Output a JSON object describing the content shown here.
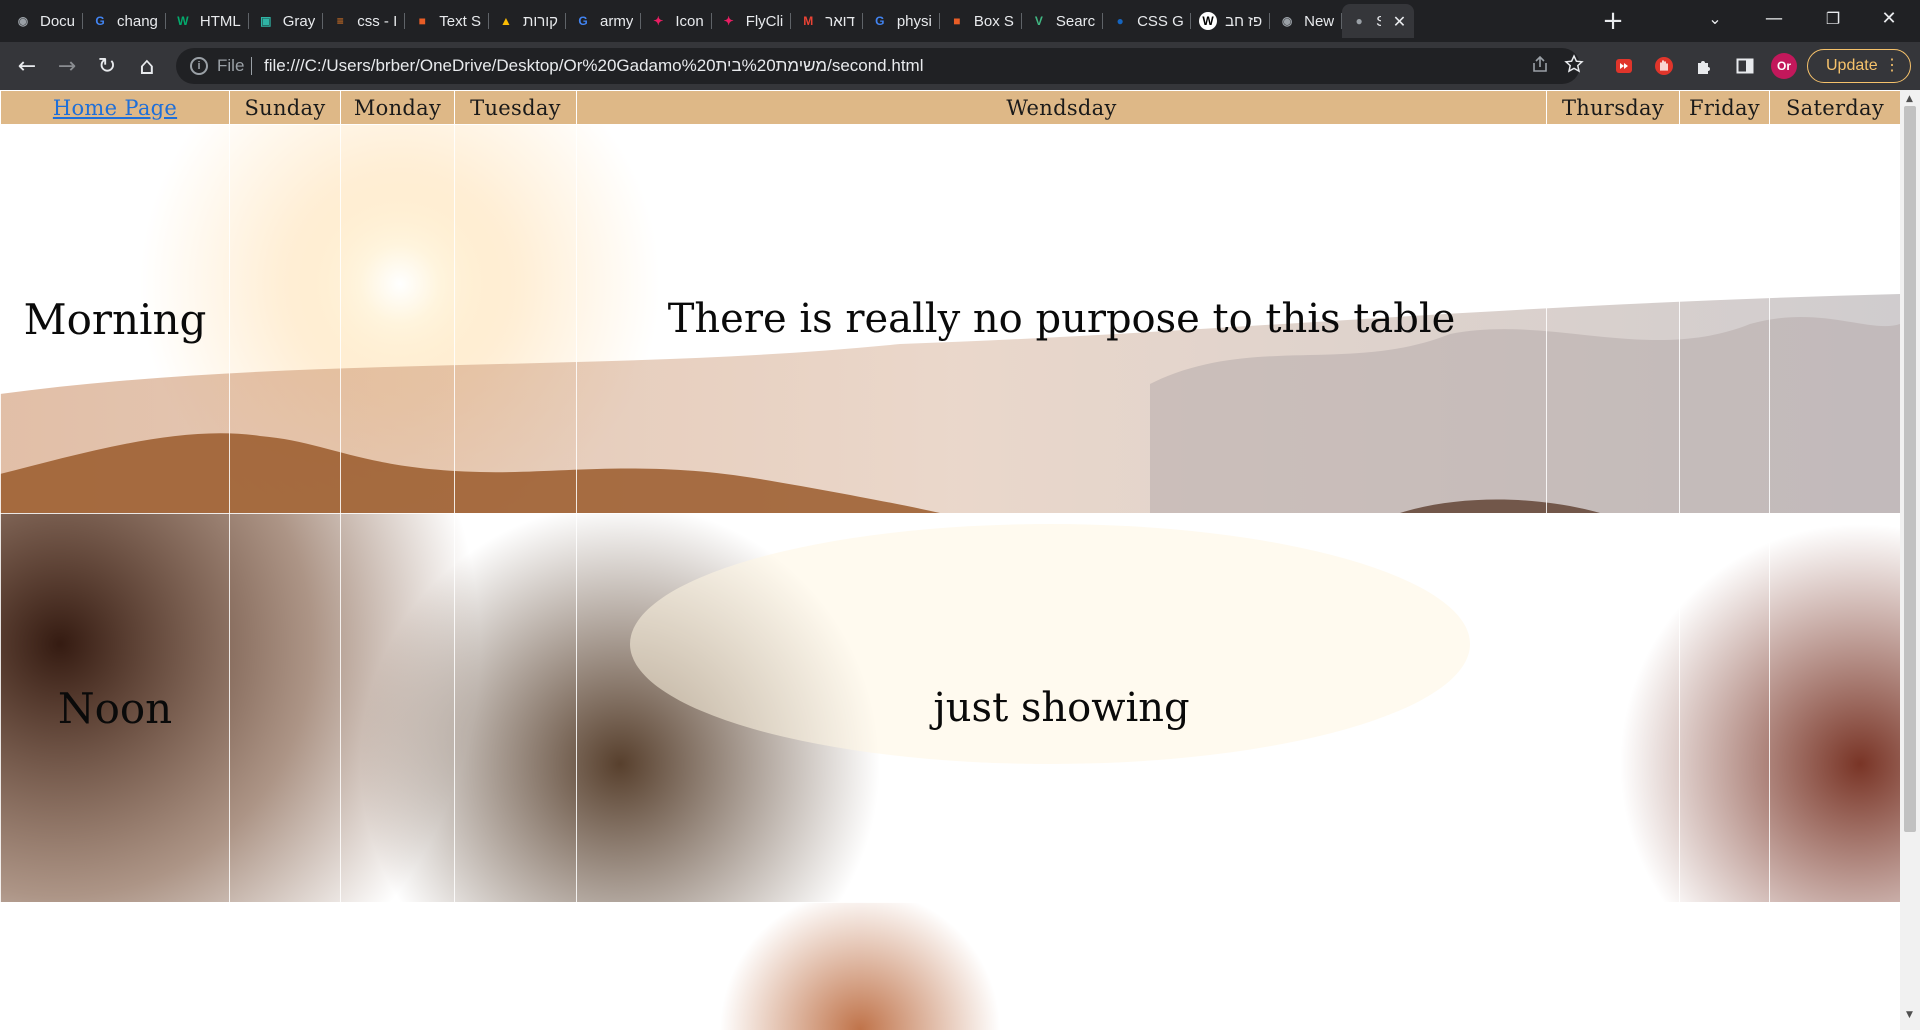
{
  "browser": {
    "tabs": [
      {
        "title": "Docu",
        "favicon": "chrome-icon",
        "color": "#9aa0a6"
      },
      {
        "title": "chang",
        "favicon": "google-icon",
        "color": "#4285f4"
      },
      {
        "title": "HTML",
        "favicon": "w3schools-icon",
        "color": "#04aa6d"
      },
      {
        "title": "Gray",
        "favicon": "grammar-icon",
        "color": "#2fb5a6"
      },
      {
        "title": "css - I",
        "favicon": "stackoverflow-icon",
        "color": "#f48024"
      },
      {
        "title": "Text S",
        "favicon": "box-icon",
        "color": "#e85d26"
      },
      {
        "title": "קורות",
        "favicon": "google-drive-icon",
        "color": "#fbbc04"
      },
      {
        "title": "army",
        "favicon": "google-icon",
        "color": "#4285f4"
      },
      {
        "title": "Icon",
        "favicon": "flycliptic-icon",
        "color": "#e91e63"
      },
      {
        "title": "FlyCli",
        "favicon": "flycliptic-icon",
        "color": "#e91e63"
      },
      {
        "title": "דואר",
        "favicon": "gmail-icon",
        "color": "#ea4335"
      },
      {
        "title": "physi",
        "favicon": "google-icon",
        "color": "#4285f4"
      },
      {
        "title": "Box S",
        "favicon": "box-icon",
        "color": "#e85d26"
      },
      {
        "title": "Searc",
        "favicon": "vue-icon",
        "color": "#41b883"
      },
      {
        "title": "CSS G",
        "favicon": "globe-icon",
        "color": "#1565c0"
      },
      {
        "title": "פז חב",
        "favicon": "wikipedia-icon",
        "color": "#ffffff"
      },
      {
        "title": "New",
        "favicon": "chrome-icon",
        "color": "#9aa0a6"
      },
      {
        "title": "Sc",
        "favicon": "globe-icon",
        "color": "#9aa0a6",
        "active": true
      }
    ],
    "new_tab_symbol": "+",
    "tab_search_symbol": "⌄",
    "window_controls": {
      "minimize": "—",
      "restore": "❐",
      "close": "✕"
    },
    "nav": {
      "back": "←",
      "forward": "→",
      "reload": "↻",
      "home": "⌂"
    },
    "omnibox": {
      "info_symbol": "i",
      "scheme": "File",
      "url": "file:///C:/Users/brber/OneDrive/Desktop/Or%20Gadamo%20משימת%20בית/second.html"
    },
    "profile_initials": "Or",
    "update_label": "Update",
    "update_menu": "⋮",
    "accent_update": "#f6c26b"
  },
  "table": {
    "header": {
      "home_link": "Home Page",
      "days": [
        "Sunday",
        "Monday",
        "Tuesday",
        "Wendsday",
        "Thursday",
        "Friday",
        "Saterday"
      ]
    },
    "rows": [
      {
        "label": "Morning",
        "center_text": "There is really no purpose to this table"
      },
      {
        "label": "Noon",
        "center_text": "just showing"
      },
      {
        "label": "",
        "center_text": ""
      }
    ],
    "header_color": "#deb887",
    "link_color": "#1e6fd9"
  }
}
